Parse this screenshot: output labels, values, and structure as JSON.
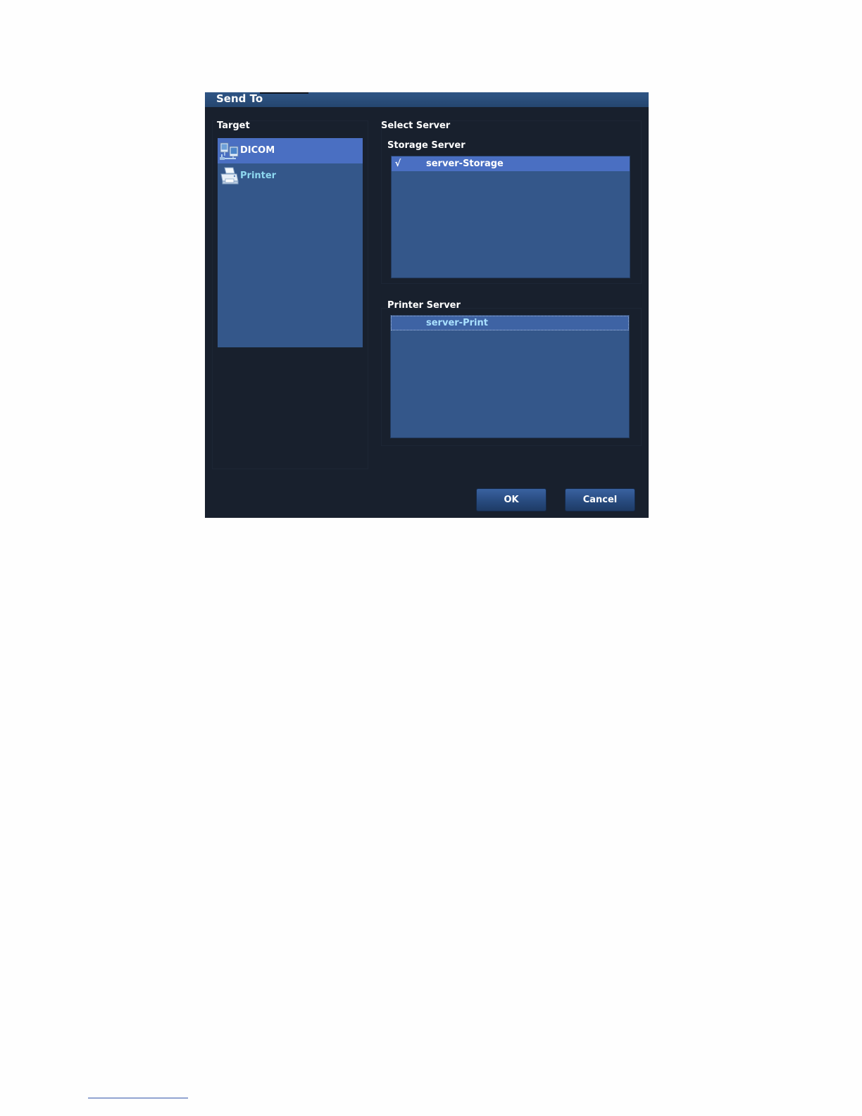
{
  "dialog": {
    "title": "Send To"
  },
  "target": {
    "label": "Target",
    "items": [
      {
        "label": "DICOM",
        "icon": "dicom-network-icon",
        "selected": true
      },
      {
        "label": "Printer",
        "icon": "printer-icon",
        "selected": false
      }
    ]
  },
  "select_server": {
    "label": "Select Server",
    "storage": {
      "label": "Storage Server",
      "rows": [
        {
          "check": "√",
          "name": "server-Storage",
          "selected": true
        }
      ]
    },
    "printer": {
      "label": "Printer Server",
      "rows": [
        {
          "check": "",
          "name": "server-Print",
          "focused": true
        }
      ]
    }
  },
  "buttons": {
    "ok": "OK",
    "cancel": "Cancel"
  },
  "colors": {
    "dialog_bg": "#18202d",
    "title_bar": "#2a4c79",
    "list_bg": "#34578a",
    "selection": "#4a6fc2",
    "printer_label": "#8ed8f0"
  }
}
